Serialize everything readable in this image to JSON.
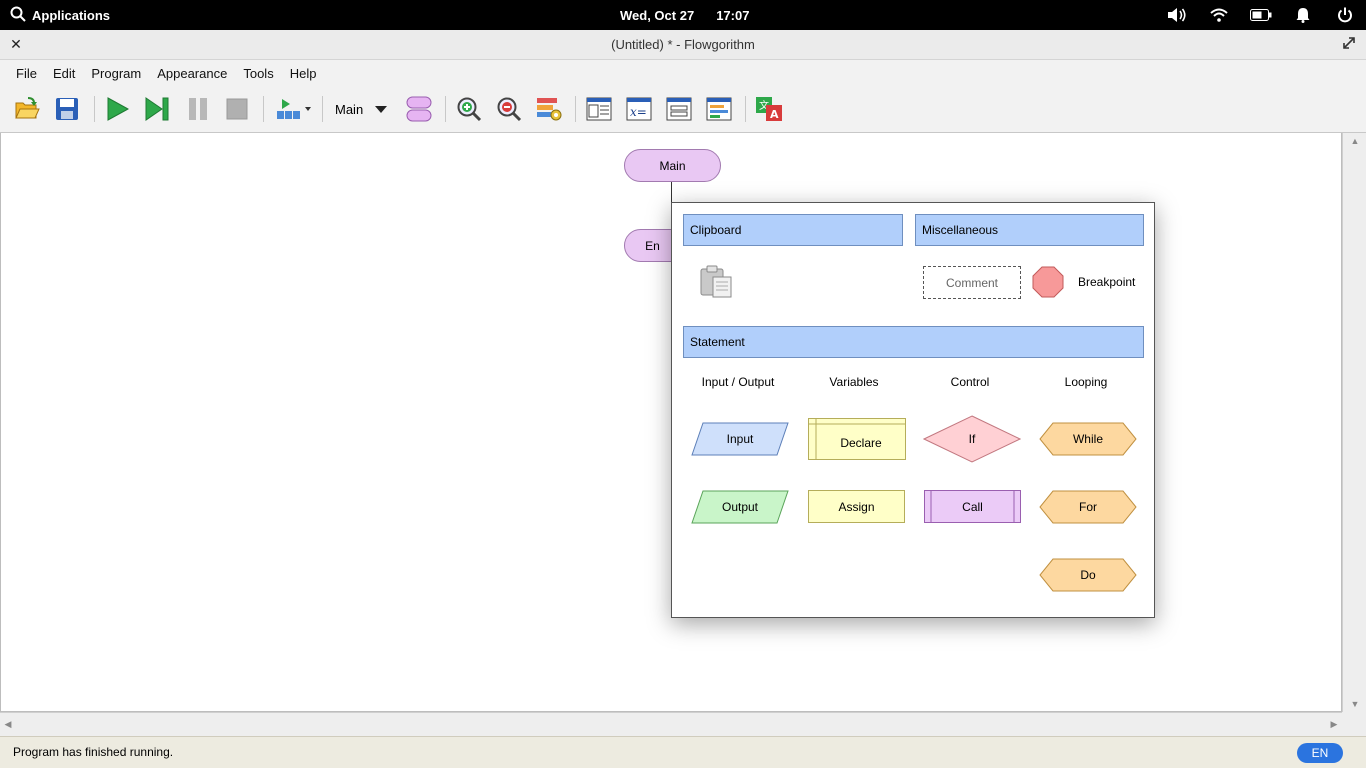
{
  "system_bar": {
    "applications_label": "Applications",
    "date": "Wed, Oct 27",
    "time": "17:07",
    "tray_icons": [
      "volume-icon",
      "wifi-icon",
      "battery-icon",
      "bell-icon",
      "power-icon"
    ]
  },
  "window": {
    "title": "(Untitled) * - Flowgorithm"
  },
  "menubar": {
    "items": [
      "File",
      "Edit",
      "Program",
      "Appearance",
      "Tools",
      "Help"
    ]
  },
  "toolbar": {
    "function_select_value": "Main"
  },
  "canvas": {
    "main_label": "Main",
    "end_label": "En"
  },
  "popup": {
    "clipboard_header": "Clipboard",
    "misc_header": "Miscellaneous",
    "comment_label": "Comment",
    "breakpoint_label": "Breakpoint",
    "statement_header": "Statement",
    "columns": [
      "Input / Output",
      "Variables",
      "Control",
      "Looping"
    ],
    "shapes": {
      "input": "Input",
      "output": "Output",
      "declare": "Declare",
      "assign": "Assign",
      "if": "If",
      "call": "Call",
      "while": "While",
      "for": "For",
      "do": "Do"
    },
    "colors": {
      "header_bg": "#b1cffb",
      "input_fill": "#cfe0fb",
      "output_fill": "#c9f5c9",
      "variable_fill": "#ffffc8",
      "control_fill": "#ffd0d4",
      "call_fill": "#ebcbf7",
      "loop_fill": "#fdd8a0",
      "breakpoint_fill": "#f79999"
    }
  },
  "statusbar": {
    "message": "Program has finished running.",
    "language": "EN"
  }
}
